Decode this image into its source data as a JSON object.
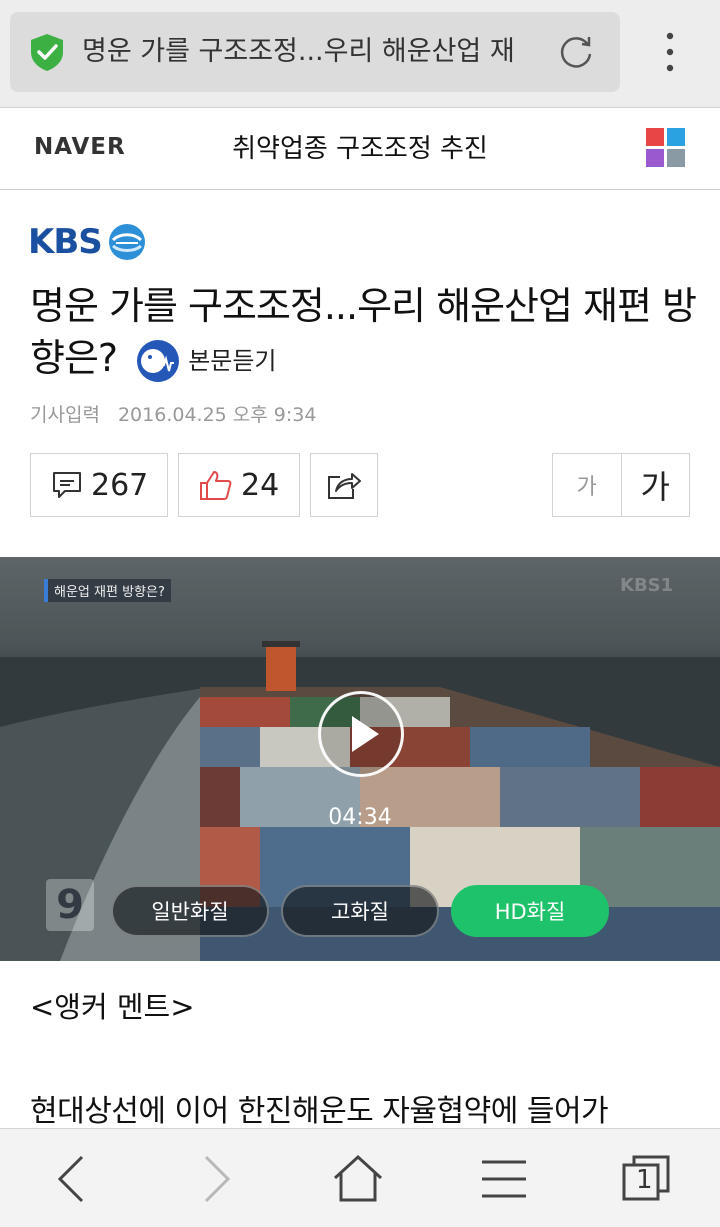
{
  "browser": {
    "url_title": "명운 가를 구조조정...우리 해운산업 재"
  },
  "header": {
    "logo": "NAVER",
    "section_title": "취약업종 구조조정 추진",
    "grid_colors": [
      "#e84646",
      "#2aa1e0",
      "#9b59d0",
      "#8a9aa4"
    ]
  },
  "article": {
    "publisher_logo": "KBS",
    "headline": "명운 가를 구조조정...우리 해운산업 재편 방향은?",
    "listen_label": "본문듣기",
    "date_label": "기사입력",
    "date_value": "2016.04.25 오후 9:34"
  },
  "actions": {
    "comment_count": "267",
    "like_count": "24",
    "font_small": "가",
    "font_large": "가"
  },
  "video": {
    "caption": "해운업 재편 방향은?",
    "watermark": "KBS1",
    "channel_mark": "9",
    "duration": "04:34",
    "quality_options": [
      "일반화질",
      "고화질",
      "HD화질"
    ],
    "selected_quality": "HD화질"
  },
  "body": {
    "anchor_note": "<앵커 멘트>",
    "first_line": "현대상선에 이어 한진해운도 자율협약에 들어가"
  },
  "bottom_nav": {
    "tab_count": "1"
  }
}
